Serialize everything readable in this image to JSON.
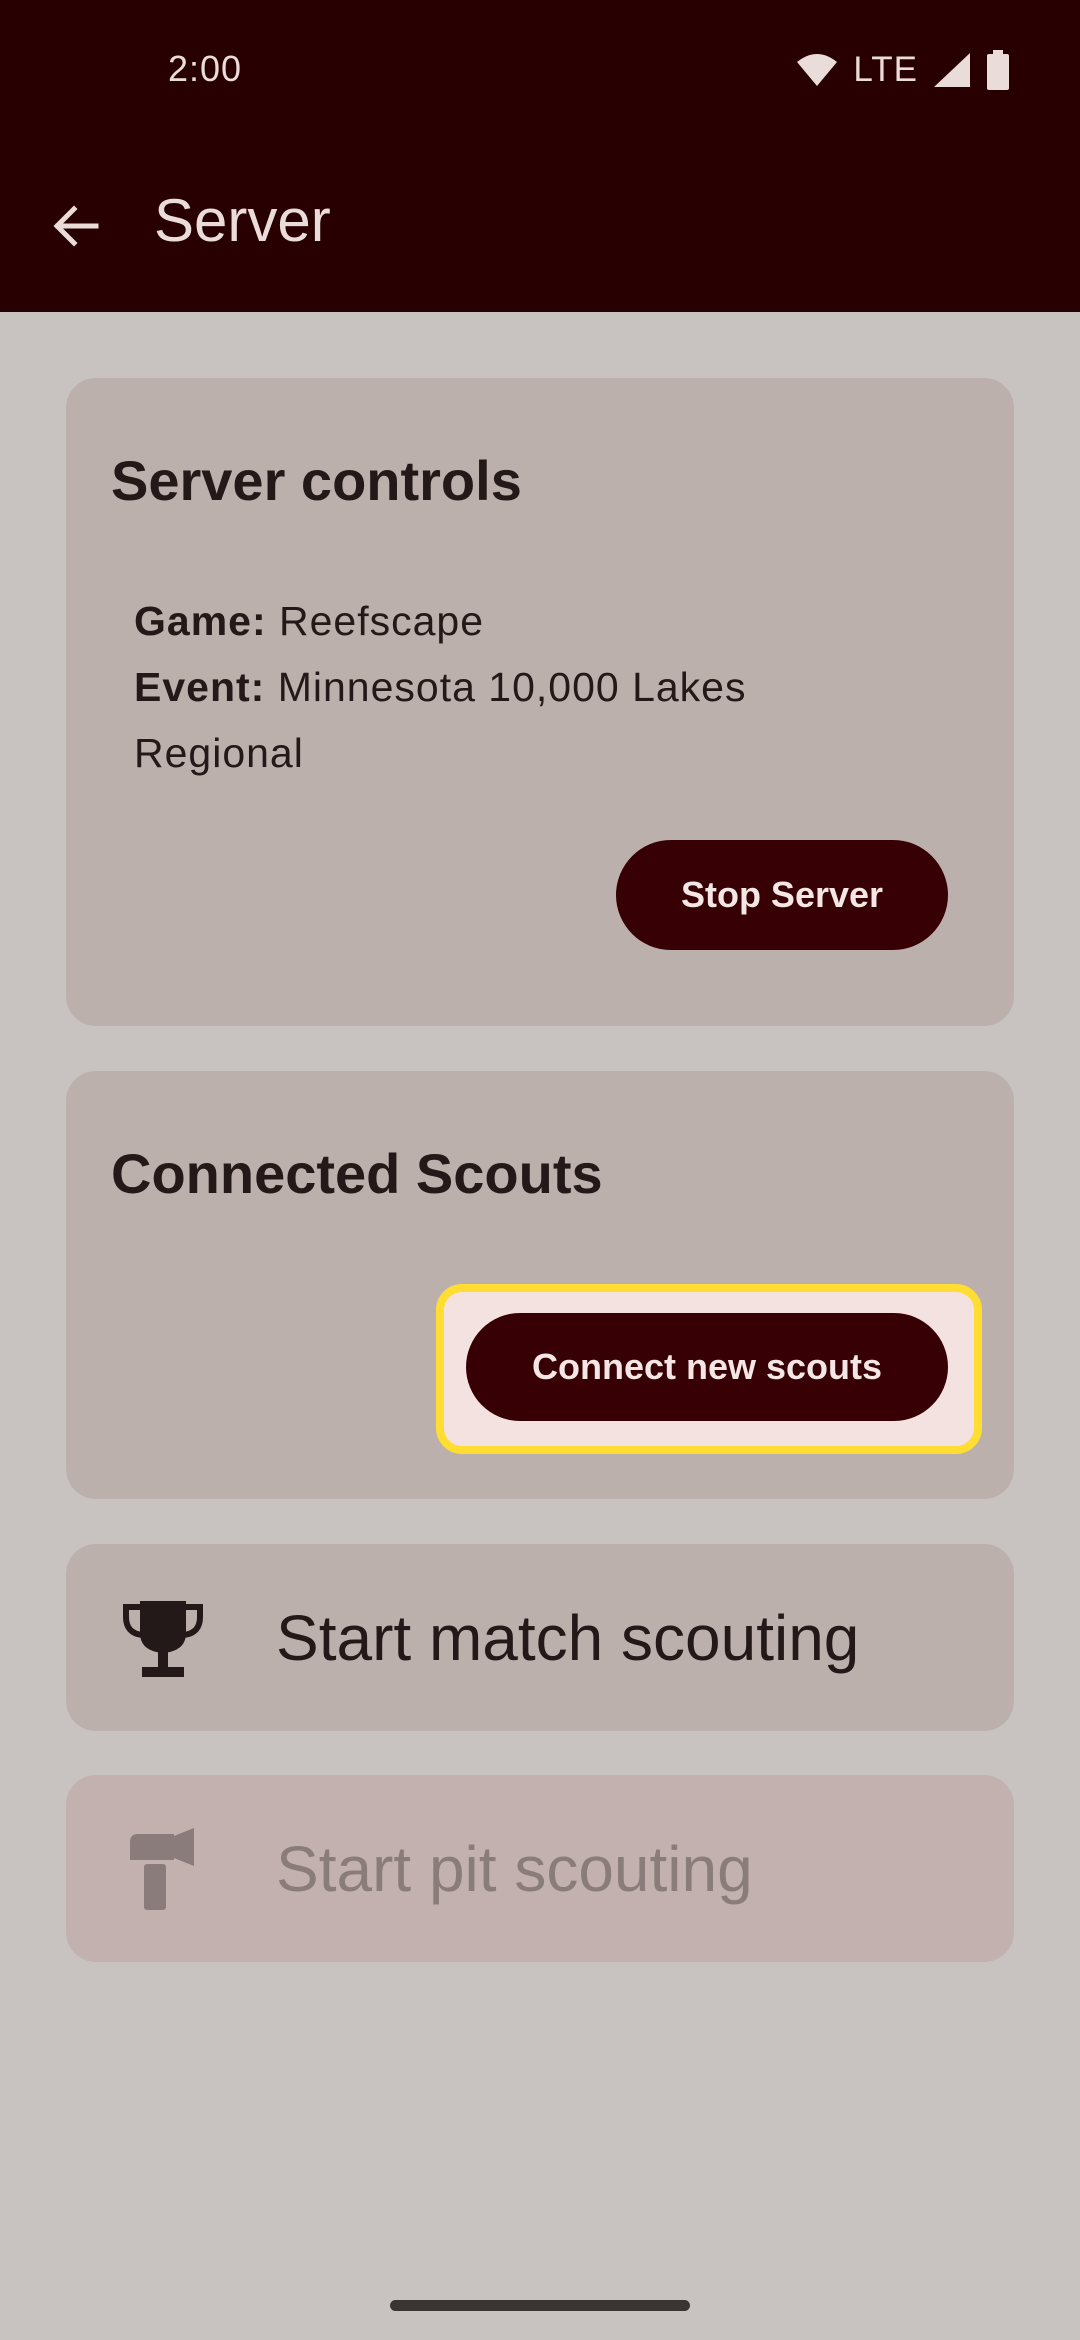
{
  "status_bar": {
    "time": "2:00",
    "network": "LTE"
  },
  "app_bar": {
    "title": "Server"
  },
  "server_controls": {
    "title": "Server controls",
    "game_label": "Game:",
    "game_value": "Reefscape",
    "event_label": "Event:",
    "event_value": "Minnesota 10,000 Lakes Regional",
    "stop_button": "Stop Server"
  },
  "connected_scouts": {
    "title": "Connected Scouts",
    "connect_button": "Connect new scouts"
  },
  "actions": {
    "match": {
      "label": "Start match scouting",
      "icon": "trophy-icon"
    },
    "pit": {
      "label": "Start pit scouting",
      "icon": "hammer-icon"
    }
  },
  "colors": {
    "app_bar": "#290002",
    "background": "#c8c3c1",
    "card": "#bcb0ad",
    "button": "#370005",
    "highlight": "#ffdd33"
  }
}
